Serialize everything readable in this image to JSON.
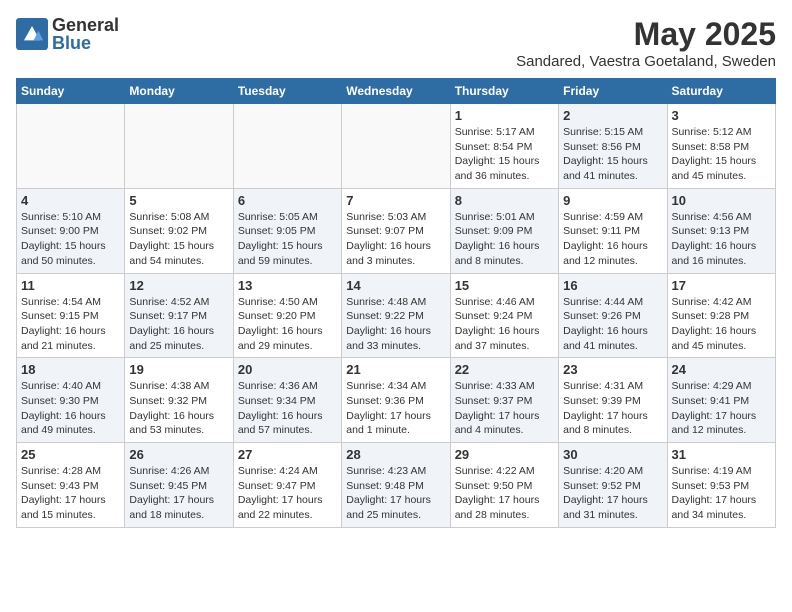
{
  "header": {
    "logo_general": "General",
    "logo_blue": "Blue",
    "month_title": "May 2025",
    "location": "Sandared, Vaestra Goetaland, Sweden"
  },
  "days_of_week": [
    "Sunday",
    "Monday",
    "Tuesday",
    "Wednesday",
    "Thursday",
    "Friday",
    "Saturday"
  ],
  "weeks": [
    [
      {
        "day": "",
        "info": "",
        "shaded": false,
        "empty": true
      },
      {
        "day": "",
        "info": "",
        "shaded": false,
        "empty": true
      },
      {
        "day": "",
        "info": "",
        "shaded": false,
        "empty": true
      },
      {
        "day": "",
        "info": "",
        "shaded": false,
        "empty": true
      },
      {
        "day": "1",
        "info": "Sunrise: 5:17 AM\nSunset: 8:54 PM\nDaylight: 15 hours\nand 36 minutes.",
        "shaded": false,
        "empty": false
      },
      {
        "day": "2",
        "info": "Sunrise: 5:15 AM\nSunset: 8:56 PM\nDaylight: 15 hours\nand 41 minutes.",
        "shaded": true,
        "empty": false
      },
      {
        "day": "3",
        "info": "Sunrise: 5:12 AM\nSunset: 8:58 PM\nDaylight: 15 hours\nand 45 minutes.",
        "shaded": false,
        "empty": false
      }
    ],
    [
      {
        "day": "4",
        "info": "Sunrise: 5:10 AM\nSunset: 9:00 PM\nDaylight: 15 hours\nand 50 minutes.",
        "shaded": true,
        "empty": false
      },
      {
        "day": "5",
        "info": "Sunrise: 5:08 AM\nSunset: 9:02 PM\nDaylight: 15 hours\nand 54 minutes.",
        "shaded": false,
        "empty": false
      },
      {
        "day": "6",
        "info": "Sunrise: 5:05 AM\nSunset: 9:05 PM\nDaylight: 15 hours\nand 59 minutes.",
        "shaded": true,
        "empty": false
      },
      {
        "day": "7",
        "info": "Sunrise: 5:03 AM\nSunset: 9:07 PM\nDaylight: 16 hours\nand 3 minutes.",
        "shaded": false,
        "empty": false
      },
      {
        "day": "8",
        "info": "Sunrise: 5:01 AM\nSunset: 9:09 PM\nDaylight: 16 hours\nand 8 minutes.",
        "shaded": true,
        "empty": false
      },
      {
        "day": "9",
        "info": "Sunrise: 4:59 AM\nSunset: 9:11 PM\nDaylight: 16 hours\nand 12 minutes.",
        "shaded": false,
        "empty": false
      },
      {
        "day": "10",
        "info": "Sunrise: 4:56 AM\nSunset: 9:13 PM\nDaylight: 16 hours\nand 16 minutes.",
        "shaded": true,
        "empty": false
      }
    ],
    [
      {
        "day": "11",
        "info": "Sunrise: 4:54 AM\nSunset: 9:15 PM\nDaylight: 16 hours\nand 21 minutes.",
        "shaded": false,
        "empty": false
      },
      {
        "day": "12",
        "info": "Sunrise: 4:52 AM\nSunset: 9:17 PM\nDaylight: 16 hours\nand 25 minutes.",
        "shaded": true,
        "empty": false
      },
      {
        "day": "13",
        "info": "Sunrise: 4:50 AM\nSunset: 9:20 PM\nDaylight: 16 hours\nand 29 minutes.",
        "shaded": false,
        "empty": false
      },
      {
        "day": "14",
        "info": "Sunrise: 4:48 AM\nSunset: 9:22 PM\nDaylight: 16 hours\nand 33 minutes.",
        "shaded": true,
        "empty": false
      },
      {
        "day": "15",
        "info": "Sunrise: 4:46 AM\nSunset: 9:24 PM\nDaylight: 16 hours\nand 37 minutes.",
        "shaded": false,
        "empty": false
      },
      {
        "day": "16",
        "info": "Sunrise: 4:44 AM\nSunset: 9:26 PM\nDaylight: 16 hours\nand 41 minutes.",
        "shaded": true,
        "empty": false
      },
      {
        "day": "17",
        "info": "Sunrise: 4:42 AM\nSunset: 9:28 PM\nDaylight: 16 hours\nand 45 minutes.",
        "shaded": false,
        "empty": false
      }
    ],
    [
      {
        "day": "18",
        "info": "Sunrise: 4:40 AM\nSunset: 9:30 PM\nDaylight: 16 hours\nand 49 minutes.",
        "shaded": true,
        "empty": false
      },
      {
        "day": "19",
        "info": "Sunrise: 4:38 AM\nSunset: 9:32 PM\nDaylight: 16 hours\nand 53 minutes.",
        "shaded": false,
        "empty": false
      },
      {
        "day": "20",
        "info": "Sunrise: 4:36 AM\nSunset: 9:34 PM\nDaylight: 16 hours\nand 57 minutes.",
        "shaded": true,
        "empty": false
      },
      {
        "day": "21",
        "info": "Sunrise: 4:34 AM\nSunset: 9:36 PM\nDaylight: 17 hours\nand 1 minute.",
        "shaded": false,
        "empty": false
      },
      {
        "day": "22",
        "info": "Sunrise: 4:33 AM\nSunset: 9:37 PM\nDaylight: 17 hours\nand 4 minutes.",
        "shaded": true,
        "empty": false
      },
      {
        "day": "23",
        "info": "Sunrise: 4:31 AM\nSunset: 9:39 PM\nDaylight: 17 hours\nand 8 minutes.",
        "shaded": false,
        "empty": false
      },
      {
        "day": "24",
        "info": "Sunrise: 4:29 AM\nSunset: 9:41 PM\nDaylight: 17 hours\nand 12 minutes.",
        "shaded": true,
        "empty": false
      }
    ],
    [
      {
        "day": "25",
        "info": "Sunrise: 4:28 AM\nSunset: 9:43 PM\nDaylight: 17 hours\nand 15 minutes.",
        "shaded": false,
        "empty": false
      },
      {
        "day": "26",
        "info": "Sunrise: 4:26 AM\nSunset: 9:45 PM\nDaylight: 17 hours\nand 18 minutes.",
        "shaded": true,
        "empty": false
      },
      {
        "day": "27",
        "info": "Sunrise: 4:24 AM\nSunset: 9:47 PM\nDaylight: 17 hours\nand 22 minutes.",
        "shaded": false,
        "empty": false
      },
      {
        "day": "28",
        "info": "Sunrise: 4:23 AM\nSunset: 9:48 PM\nDaylight: 17 hours\nand 25 minutes.",
        "shaded": true,
        "empty": false
      },
      {
        "day": "29",
        "info": "Sunrise: 4:22 AM\nSunset: 9:50 PM\nDaylight: 17 hours\nand 28 minutes.",
        "shaded": false,
        "empty": false
      },
      {
        "day": "30",
        "info": "Sunrise: 4:20 AM\nSunset: 9:52 PM\nDaylight: 17 hours\nand 31 minutes.",
        "shaded": true,
        "empty": false
      },
      {
        "day": "31",
        "info": "Sunrise: 4:19 AM\nSunset: 9:53 PM\nDaylight: 17 hours\nand 34 minutes.",
        "shaded": false,
        "empty": false
      }
    ]
  ]
}
